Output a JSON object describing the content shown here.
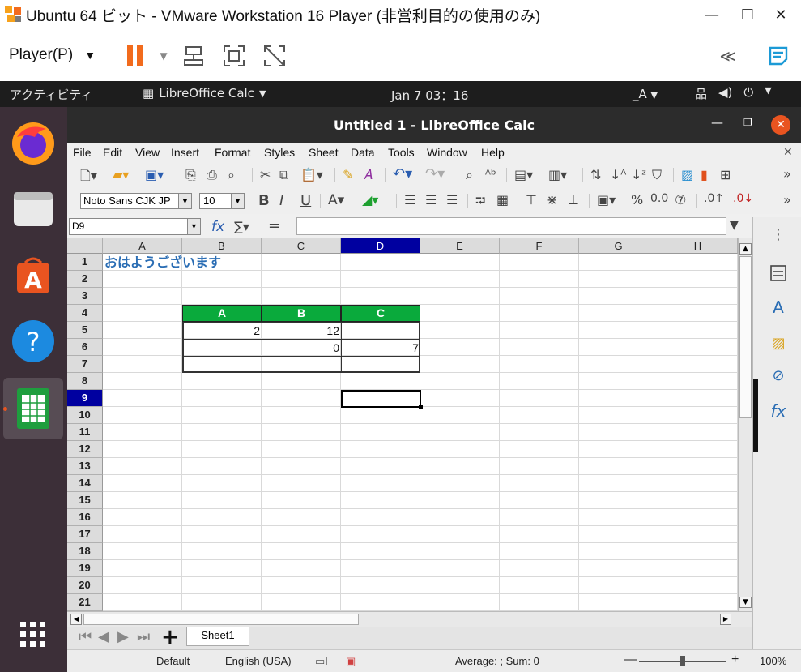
{
  "vmware": {
    "title": "Ubuntu 64 ビット - VMware Workstation 16 Player (非営利目的の使用のみ)",
    "player_menu": "Player(P)",
    "controls": {
      "minimize": "—",
      "maximize": "☐",
      "close": "✕"
    }
  },
  "gnome": {
    "activities": "アクティビティ",
    "app_menu": "LibreOffice Calc",
    "clock": "Jan 7  03：16",
    "input_method": "_A"
  },
  "calc": {
    "window_title": "Untitled 1 - LibreOffice Calc",
    "menu": [
      "File",
      "Edit",
      "View",
      "Insert",
      "Format",
      "Styles",
      "Sheet",
      "Data",
      "Tools",
      "Window",
      "Help"
    ],
    "font_name": "Noto Sans CJK JP",
    "font_size": "10",
    "name_box": "D9",
    "columns": [
      "A",
      "B",
      "C",
      "D",
      "E",
      "F",
      "G",
      "H"
    ],
    "selected_column": "D",
    "rows": [
      "1",
      "2",
      "3",
      "4",
      "5",
      "6",
      "7",
      "8",
      "9",
      "10",
      "11",
      "12",
      "13",
      "14",
      "15",
      "16",
      "17",
      "18",
      "19",
      "20",
      "21"
    ],
    "selected_row": "9",
    "cells": {
      "A1": "おはようございます",
      "B4": "A",
      "C4": "B",
      "D4": "C",
      "B5": "2",
      "C5": "12",
      "C6": "0",
      "D6": "7"
    },
    "sheet_tab": "Sheet1",
    "status": {
      "page_style": "Default",
      "language": "English (USA)",
      "summary": "Average: ; Sum: 0",
      "zoom": "100%"
    },
    "colors": {
      "header_fill": "#0aaa3c",
      "title_text": "#2a6db4",
      "selected_header": "#0000a0"
    }
  }
}
